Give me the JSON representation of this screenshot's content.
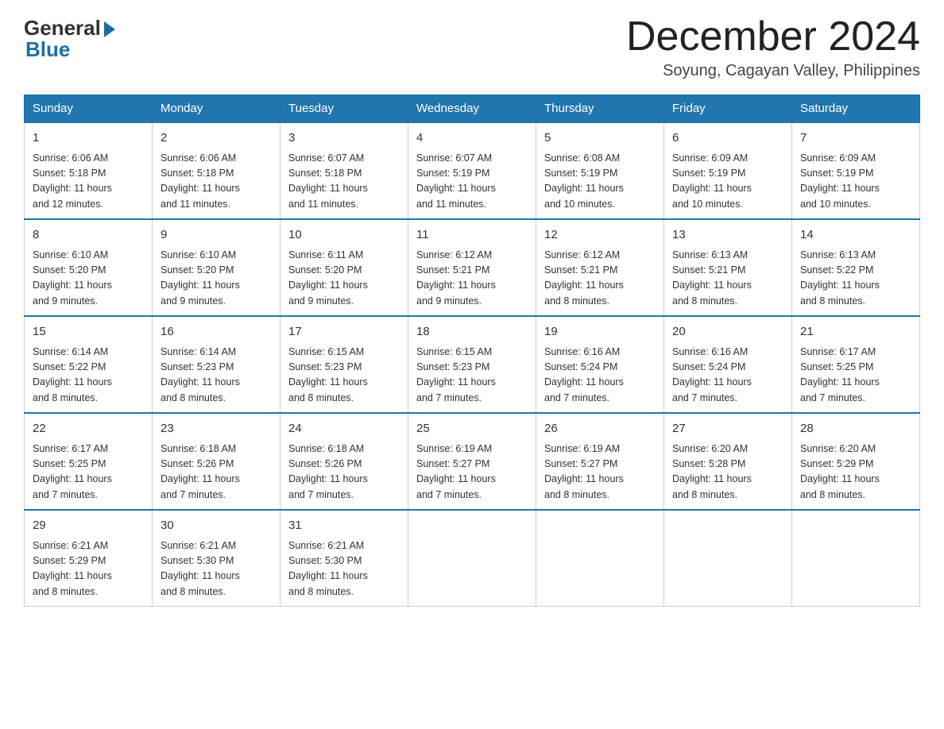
{
  "header": {
    "logo_general": "General",
    "logo_blue": "Blue",
    "month_title": "December 2024",
    "location": "Soyung, Cagayan Valley, Philippines"
  },
  "days_of_week": [
    "Sunday",
    "Monday",
    "Tuesday",
    "Wednesday",
    "Thursday",
    "Friday",
    "Saturday"
  ],
  "weeks": [
    [
      {
        "day": "1",
        "sunrise": "6:06 AM",
        "sunset": "5:18 PM",
        "daylight": "11 hours and 12 minutes."
      },
      {
        "day": "2",
        "sunrise": "6:06 AM",
        "sunset": "5:18 PM",
        "daylight": "11 hours and 11 minutes."
      },
      {
        "day": "3",
        "sunrise": "6:07 AM",
        "sunset": "5:18 PM",
        "daylight": "11 hours and 11 minutes."
      },
      {
        "day": "4",
        "sunrise": "6:07 AM",
        "sunset": "5:19 PM",
        "daylight": "11 hours and 11 minutes."
      },
      {
        "day": "5",
        "sunrise": "6:08 AM",
        "sunset": "5:19 PM",
        "daylight": "11 hours and 10 minutes."
      },
      {
        "day": "6",
        "sunrise": "6:09 AM",
        "sunset": "5:19 PM",
        "daylight": "11 hours and 10 minutes."
      },
      {
        "day": "7",
        "sunrise": "6:09 AM",
        "sunset": "5:19 PM",
        "daylight": "11 hours and 10 minutes."
      }
    ],
    [
      {
        "day": "8",
        "sunrise": "6:10 AM",
        "sunset": "5:20 PM",
        "daylight": "11 hours and 9 minutes."
      },
      {
        "day": "9",
        "sunrise": "6:10 AM",
        "sunset": "5:20 PM",
        "daylight": "11 hours and 9 minutes."
      },
      {
        "day": "10",
        "sunrise": "6:11 AM",
        "sunset": "5:20 PM",
        "daylight": "11 hours and 9 minutes."
      },
      {
        "day": "11",
        "sunrise": "6:12 AM",
        "sunset": "5:21 PM",
        "daylight": "11 hours and 9 minutes."
      },
      {
        "day": "12",
        "sunrise": "6:12 AM",
        "sunset": "5:21 PM",
        "daylight": "11 hours and 8 minutes."
      },
      {
        "day": "13",
        "sunrise": "6:13 AM",
        "sunset": "5:21 PM",
        "daylight": "11 hours and 8 minutes."
      },
      {
        "day": "14",
        "sunrise": "6:13 AM",
        "sunset": "5:22 PM",
        "daylight": "11 hours and 8 minutes."
      }
    ],
    [
      {
        "day": "15",
        "sunrise": "6:14 AM",
        "sunset": "5:22 PM",
        "daylight": "11 hours and 8 minutes."
      },
      {
        "day": "16",
        "sunrise": "6:14 AM",
        "sunset": "5:23 PM",
        "daylight": "11 hours and 8 minutes."
      },
      {
        "day": "17",
        "sunrise": "6:15 AM",
        "sunset": "5:23 PM",
        "daylight": "11 hours and 8 minutes."
      },
      {
        "day": "18",
        "sunrise": "6:15 AM",
        "sunset": "5:23 PM",
        "daylight": "11 hours and 7 minutes."
      },
      {
        "day": "19",
        "sunrise": "6:16 AM",
        "sunset": "5:24 PM",
        "daylight": "11 hours and 7 minutes."
      },
      {
        "day": "20",
        "sunrise": "6:16 AM",
        "sunset": "5:24 PM",
        "daylight": "11 hours and 7 minutes."
      },
      {
        "day": "21",
        "sunrise": "6:17 AM",
        "sunset": "5:25 PM",
        "daylight": "11 hours and 7 minutes."
      }
    ],
    [
      {
        "day": "22",
        "sunrise": "6:17 AM",
        "sunset": "5:25 PM",
        "daylight": "11 hours and 7 minutes."
      },
      {
        "day": "23",
        "sunrise": "6:18 AM",
        "sunset": "5:26 PM",
        "daylight": "11 hours and 7 minutes."
      },
      {
        "day": "24",
        "sunrise": "6:18 AM",
        "sunset": "5:26 PM",
        "daylight": "11 hours and 7 minutes."
      },
      {
        "day": "25",
        "sunrise": "6:19 AM",
        "sunset": "5:27 PM",
        "daylight": "11 hours and 7 minutes."
      },
      {
        "day": "26",
        "sunrise": "6:19 AM",
        "sunset": "5:27 PM",
        "daylight": "11 hours and 8 minutes."
      },
      {
        "day": "27",
        "sunrise": "6:20 AM",
        "sunset": "5:28 PM",
        "daylight": "11 hours and 8 minutes."
      },
      {
        "day": "28",
        "sunrise": "6:20 AM",
        "sunset": "5:29 PM",
        "daylight": "11 hours and 8 minutes."
      }
    ],
    [
      {
        "day": "29",
        "sunrise": "6:21 AM",
        "sunset": "5:29 PM",
        "daylight": "11 hours and 8 minutes."
      },
      {
        "day": "30",
        "sunrise": "6:21 AM",
        "sunset": "5:30 PM",
        "daylight": "11 hours and 8 minutes."
      },
      {
        "day": "31",
        "sunrise": "6:21 AM",
        "sunset": "5:30 PM",
        "daylight": "11 hours and 8 minutes."
      },
      null,
      null,
      null,
      null
    ]
  ],
  "labels": {
    "sunrise": "Sunrise:",
    "sunset": "Sunset:",
    "daylight": "Daylight:"
  }
}
